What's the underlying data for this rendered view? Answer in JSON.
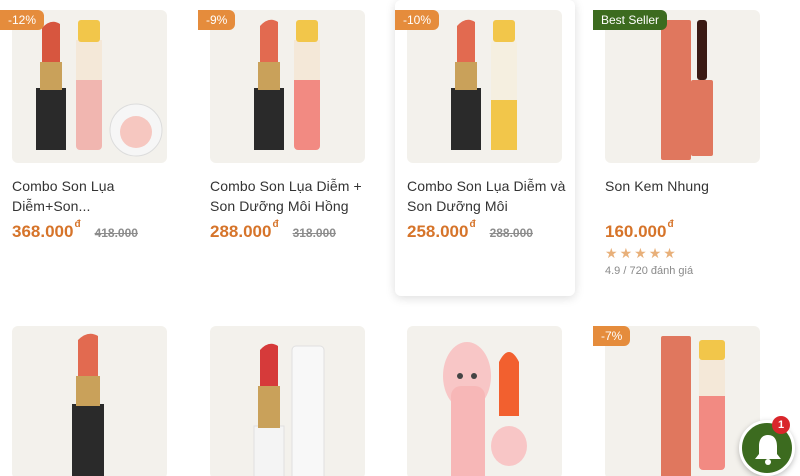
{
  "products": [
    {
      "badge": "-12%",
      "name": "Combo Son Lụa Diễm+Son...",
      "price": "368.000",
      "old_price": "418.000",
      "currency": "đ"
    },
    {
      "badge": "-9%",
      "name": "Combo Son Lụa Diễm + Son Dưỡng Môi Hồng",
      "price": "288.000",
      "old_price": "318.000",
      "currency": "đ"
    },
    {
      "badge": "-10%",
      "name": "Combo Son Lụa Diễm và Son Dưỡng Môi",
      "price": "258.000",
      "old_price": "288.000",
      "currency": "đ"
    },
    {
      "badge": "Best Seller",
      "name": "Son Kem Nhung",
      "price": "160.000",
      "currency": "đ",
      "rating_stars": 5,
      "rating_text": "4.9 / 720 đánh giá"
    },
    {
      "badge": "",
      "name": ""
    },
    {
      "badge": "",
      "name": ""
    },
    {
      "badge": "",
      "name": ""
    },
    {
      "badge": "-7%",
      "name": ""
    }
  ],
  "notification": {
    "count": "1"
  },
  "colors": {
    "accent": "#d6742a",
    "badge": "#e58c3c",
    "bestseller": "#3c6b1f",
    "thumb_bg": "#f3f1ec"
  }
}
